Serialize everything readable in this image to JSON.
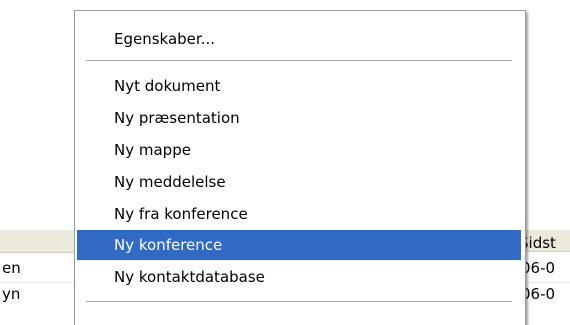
{
  "background_list": {
    "column_header_right": "Sidst",
    "rows": [
      {
        "left": "en",
        "right": "06-0"
      },
      {
        "left": "yn",
        "right": "06-0"
      }
    ]
  },
  "context_menu": {
    "items": [
      {
        "label": "Egenskaber..."
      },
      {
        "label": "Nyt dokument"
      },
      {
        "label": "Ny præsentation"
      },
      {
        "label": "Ny mappe"
      },
      {
        "label": "Ny meddelelse"
      },
      {
        "label": "Ny fra konference"
      },
      {
        "label": "Ny konference",
        "highlighted": true
      },
      {
        "label": "Ny kontaktdatabase"
      }
    ]
  },
  "colors": {
    "highlight": "#316ac5",
    "header_background": "#ebeadb"
  }
}
